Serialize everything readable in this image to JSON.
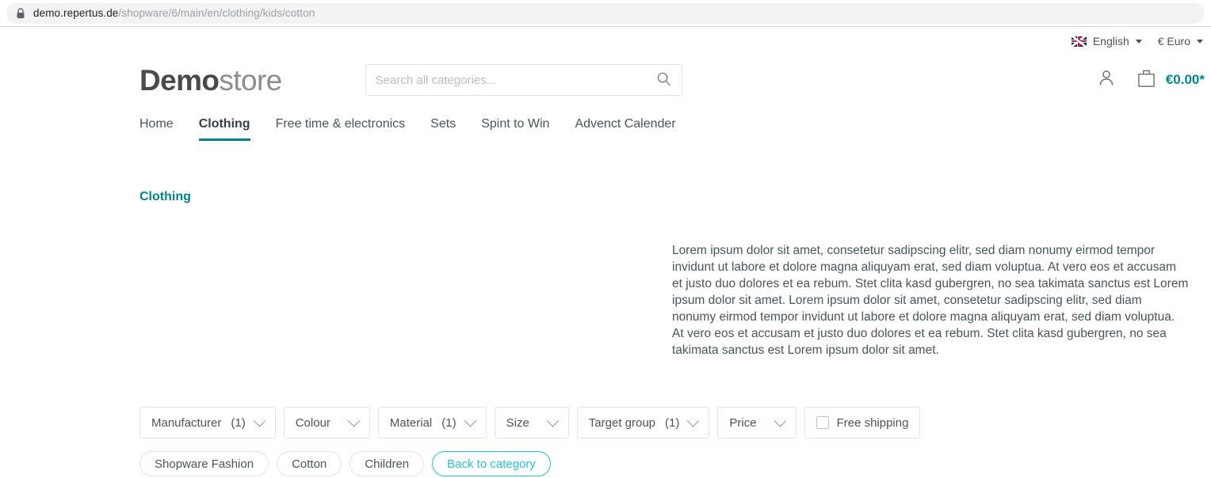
{
  "browser": {
    "lock_icon": "lock-icon",
    "url_host": "demo.repertus.de",
    "url_path": "/shopware/6/main/en/clothing/kids/cotton"
  },
  "topbar": {
    "flag_icon": "uk-flag-icon",
    "language": "English",
    "language_caret": "caret-down-icon",
    "currency": "€ Euro"
  },
  "header": {
    "logo_bold": "Demo",
    "logo_light": "store",
    "search": {
      "placeholder": "Search all categories...",
      "value": "",
      "icon": "search-icon"
    },
    "account_icon": "person-icon",
    "cart_icon": "shopping-bag-icon",
    "cart_total": "€0.00*"
  },
  "nav": {
    "items": [
      {
        "label": "Home",
        "active": false
      },
      {
        "label": "Clothing",
        "active": true
      },
      {
        "label": "Free time & electronics",
        "active": false
      },
      {
        "label": "Sets",
        "active": false
      },
      {
        "label": "Spint to Win",
        "active": false
      },
      {
        "label": "Advenct Calender",
        "active": false
      }
    ]
  },
  "category": {
    "heading": "Clothing",
    "description": "Lorem ipsum dolor sit amet, consetetur sadipscing elitr, sed diam nonumy eirmod tempor invidunt ut labore et dolore magna aliquyam erat, sed diam voluptua. At vero eos et accusam et justo duo dolores et ea rebum. Stet clita kasd gubergren, no sea takimata sanctus est Lorem ipsum dolor sit amet. Lorem ipsum dolor sit amet, consetetur sadipscing elitr, sed diam nonumy eirmod tempor invidunt ut labore et dolore magna aliquyam erat, sed diam voluptua. At vero eos et accusam et justo duo dolores et ea rebum. Stet clita kasd gubergren, no sea takimata sanctus est Lorem ipsum dolor sit amet."
  },
  "filters": {
    "dropdowns": [
      {
        "label": "Manufacturer",
        "count": "(1)"
      },
      {
        "label": "Colour",
        "count": ""
      },
      {
        "label": "Material",
        "count": "(1)"
      },
      {
        "label": "Size",
        "count": ""
      },
      {
        "label": "Target group",
        "count": "(1)"
      },
      {
        "label": "Price",
        "count": ""
      }
    ],
    "checkbox": {
      "label": "Free shipping",
      "checked": false
    }
  },
  "active_filters": {
    "pills": [
      {
        "label": "Shopware Fashion",
        "reset": false
      },
      {
        "label": "Cotton",
        "reset": false
      },
      {
        "label": "Children",
        "reset": false
      },
      {
        "label": "Back to category",
        "reset": true
      }
    ]
  },
  "colors": {
    "accent_teal": "#008490",
    "accent_cyan": "#1fc3e8",
    "text": "#4a545b",
    "border": "#dfe3e6"
  }
}
